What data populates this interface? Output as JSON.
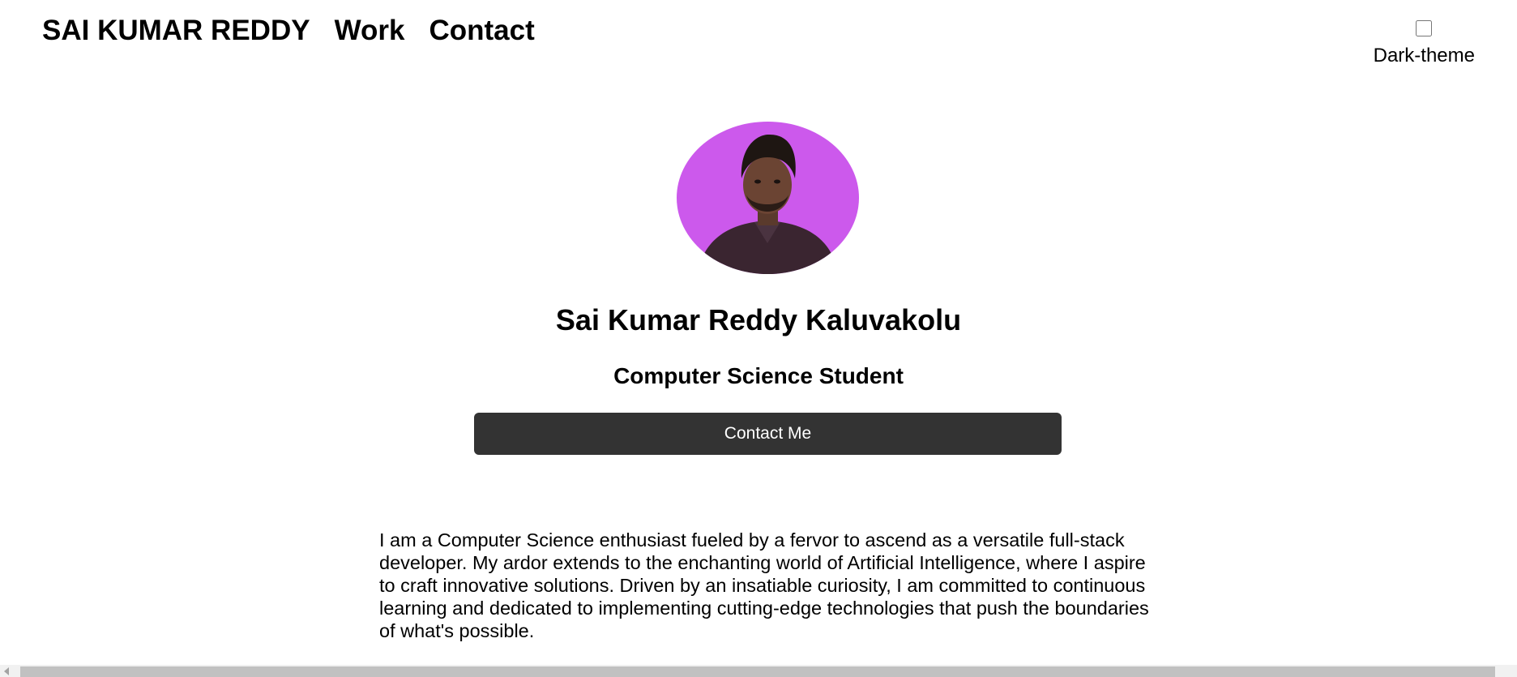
{
  "nav": {
    "brand": "SAI KUMAR REDDY",
    "work": "Work",
    "contact": "Contact"
  },
  "theme_toggle": {
    "label": "Dark-theme",
    "checked": false
  },
  "hero": {
    "avatar_bg": "#cc59ec",
    "name": "Sai Kumar Reddy Kaluvakolu",
    "role": "Computer Science Student",
    "cta_label": "Contact Me",
    "cta_bg": "#333333"
  },
  "about": {
    "text": "I am a Computer Science enthusiast fueled by a fervor to ascend as a versatile full-stack developer. My ardor extends to the enchanting world of Artificial Intelligence, where I aspire to craft innovative solutions. Driven by an insatiable curiosity, I am committed to continuous learning and dedicated to implementing cutting-edge technologies that push the boundaries of what's possible."
  },
  "icons": {
    "scroll_left": "chevron-left-icon"
  }
}
